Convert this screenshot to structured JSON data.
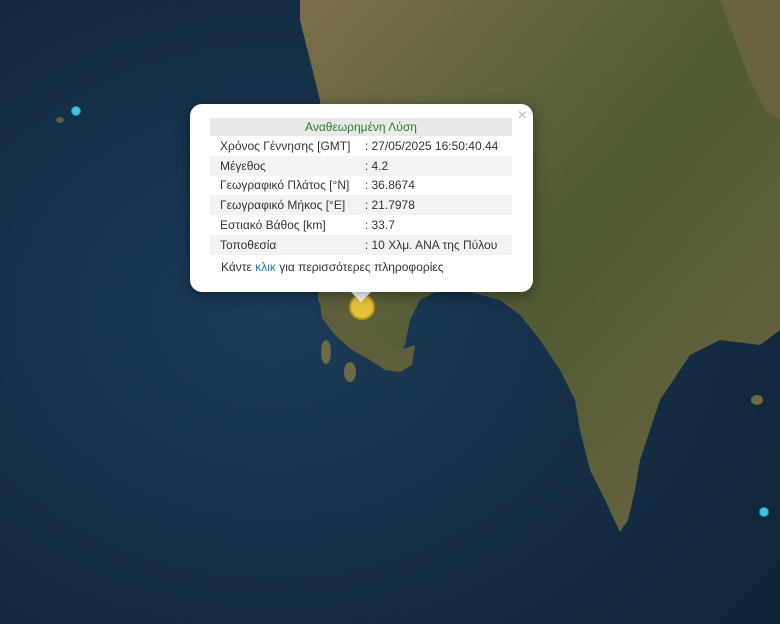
{
  "popup": {
    "title": "Αναθεωρημένη Λύση",
    "close_symbol": "×",
    "rows": [
      {
        "label": "Χρόνος Γέννησης [GMT]",
        "value": ": 27/05/2025 16:50:40.44"
      },
      {
        "label": "Μέγεθος",
        "value": ": 4.2"
      },
      {
        "label": "Γεωγραφικό Πλάτος [°N]",
        "value": ": 36.8674"
      },
      {
        "label": "Γεωγραφικό Μήκος [°E]",
        "value": ": 21.7978"
      },
      {
        "label": "Εστιακό Βάθος [km]",
        "value": ": 33.7"
      },
      {
        "label": "Τοποθεσία",
        "value": ": 10 Χλμ. ΑΝΑ της Πύλου"
      }
    ],
    "more_prefix": "Κάντε ",
    "more_link": "κλικ",
    "more_suffix": " για περισσότερες πληροφορίες"
  },
  "colors": {
    "sea": "#16304a",
    "land": "#6b6a45",
    "title_green": "#2e7d32",
    "link_blue": "#1f7bb8",
    "marker_main": "#e6c23a",
    "marker_small": "#3ec6e0"
  }
}
